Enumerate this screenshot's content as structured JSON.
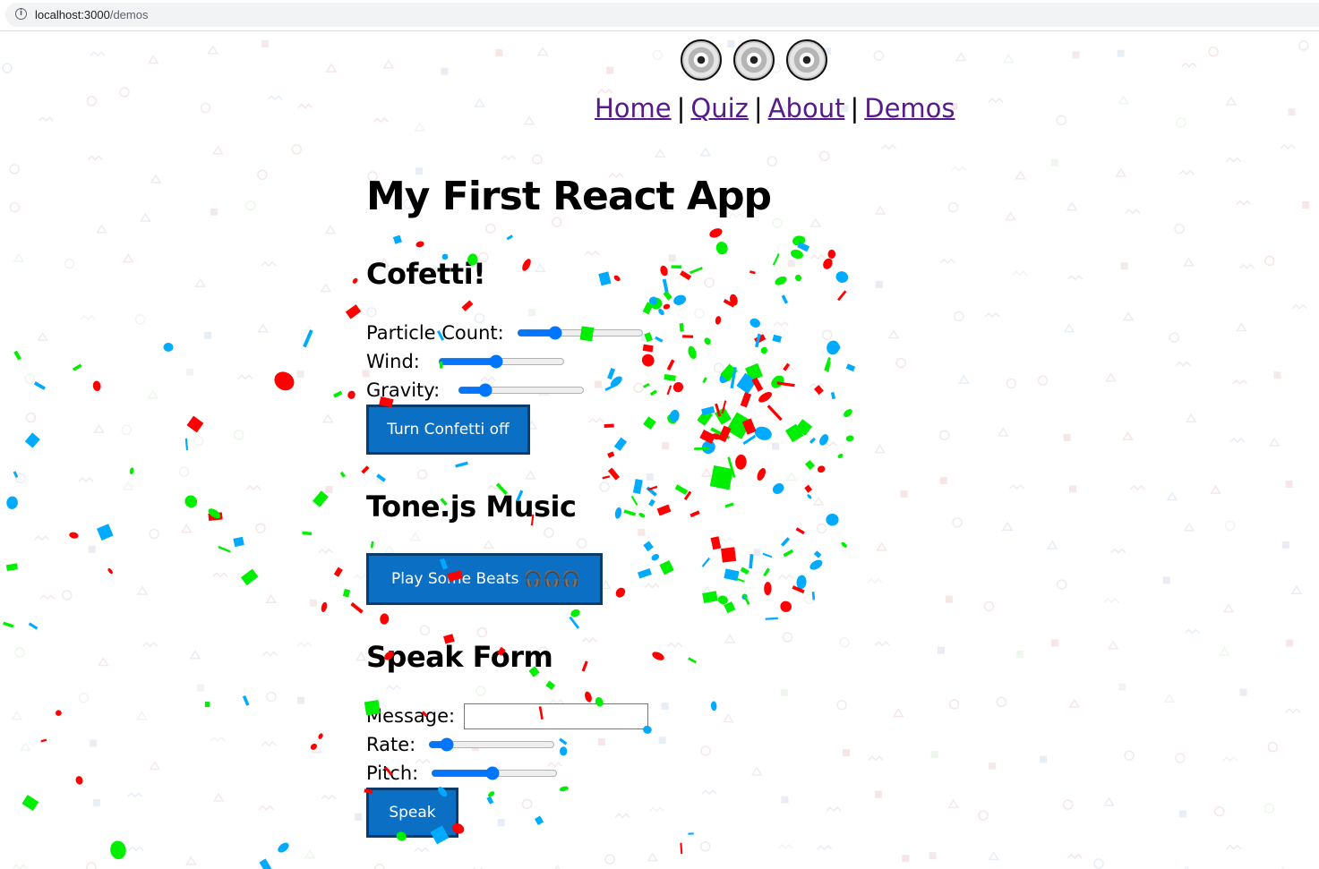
{
  "browser": {
    "url_host": "localhost:3000",
    "url_path": "/demos",
    "info_icon": "info-icon"
  },
  "header": {
    "logo_icon": "compact-disc-icon",
    "nav": [
      {
        "label": "Home"
      },
      {
        "label": "Quiz"
      },
      {
        "label": "About"
      },
      {
        "label": "Demos"
      }
    ],
    "separator": "|",
    "link_color": "#551a8b"
  },
  "page": {
    "title": "My First React App"
  },
  "confetti_section": {
    "heading": "Cofetti!",
    "sliders": [
      {
        "label": "Particle Count:",
        "value": 0.28
      },
      {
        "label": "Wind:",
        "value": 0.45
      },
      {
        "label": "Gravity:",
        "value": 0.18
      }
    ],
    "button_label": "Turn Confetti off"
  },
  "music_section": {
    "heading": "Tone.js Music",
    "button_label": "Play Some Beats 🎧🎧🎧"
  },
  "speak_section": {
    "heading": "Speak Form",
    "message_label": "Message:",
    "message_value": "",
    "rate_label": "Rate:",
    "rate_value": 0.1,
    "pitch_label": "Pitch:",
    "pitch_value": 0.48,
    "button_label": "Speak"
  },
  "colors": {
    "button_bg": "#0b6fc4",
    "button_border": "#0a3c6b",
    "slider_accent": "#0075ff",
    "confetti": [
      "#ff0000",
      "#00ee00",
      "#00aaff"
    ]
  }
}
